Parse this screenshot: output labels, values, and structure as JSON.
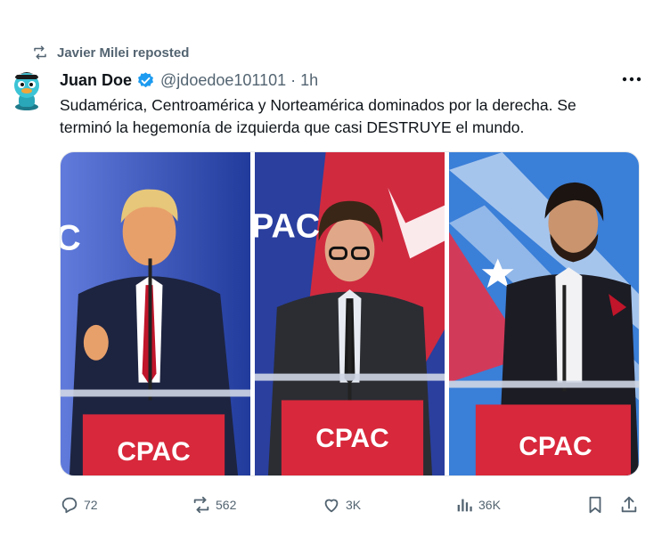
{
  "repost": {
    "label": "Javier Milei reposted",
    "icon": "repost-icon"
  },
  "author": {
    "name": "Juan Doe",
    "verified": true,
    "handle": "@jdoedoe101101",
    "separator": "·",
    "time": "1h"
  },
  "post": {
    "line1": "Sudamérica, Centroamérica y Norteamérica dominados por la derecha. Se",
    "line2": "terminó la hegemonía de izquierda que casi DESTRUYE el mundo."
  },
  "media": {
    "panels": [
      {
        "podium_text": "CPAC",
        "backdrop_text": "C"
      },
      {
        "podium_text": "CPAC",
        "backdrop_text": "PAC"
      },
      {
        "podium_text": "CPAC",
        "backdrop_text": ""
      }
    ]
  },
  "actions": {
    "replies": "72",
    "reposts": "562",
    "likes": "3K",
    "views": "36K"
  },
  "colors": {
    "accent": "#1d9bf0",
    "secondary_text": "#536471",
    "cpac_red": "#d8283b",
    "cpac_blue": "#2b4fb8"
  }
}
